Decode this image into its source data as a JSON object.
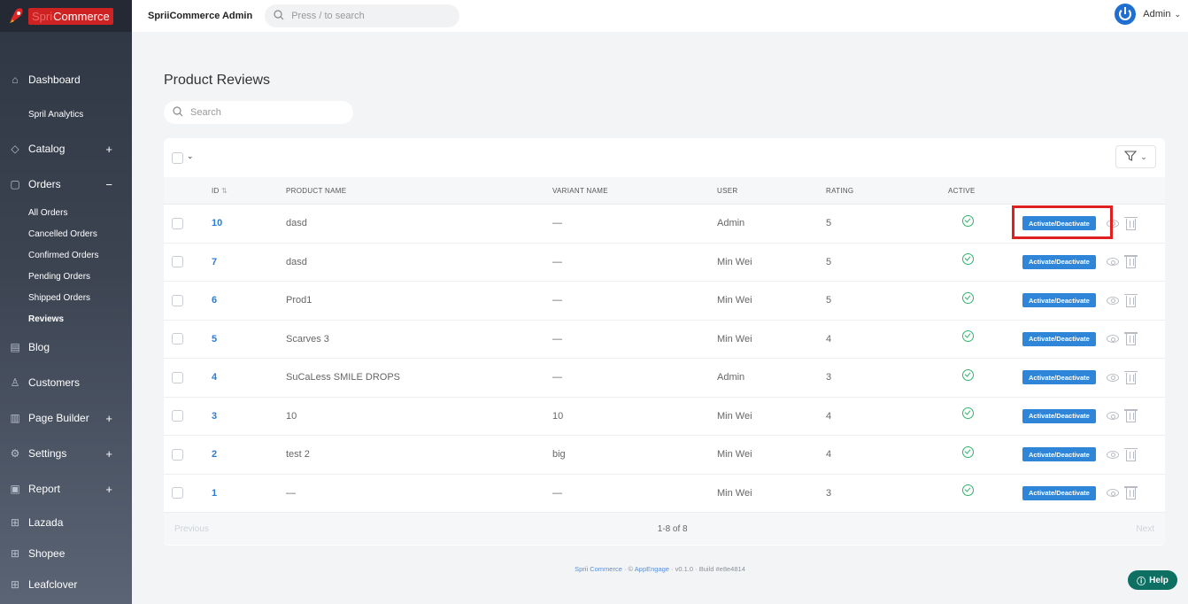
{
  "brand": {
    "name_faded": "Spri",
    "name": "Commerce"
  },
  "topbar": {
    "title": "SpriiCommerce Admin",
    "search_placeholder": "Press / to search",
    "user": "Admin"
  },
  "sidebar": {
    "items": [
      {
        "label": "Dashboard",
        "icon": "home-icon",
        "plus": ""
      },
      {
        "label": "Spril Analytics",
        "icon": "",
        "plus": ""
      },
      {
        "label": "Catalog",
        "icon": "tag-icon",
        "plus": "+"
      },
      {
        "label": "Orders",
        "icon": "bag-icon",
        "plus": "−"
      }
    ],
    "order_subitems": [
      "All Orders",
      "Cancelled Orders",
      "Confirmed Orders",
      "Pending Orders",
      "Shipped Orders",
      "Reviews"
    ],
    "items2": [
      {
        "label": "Blog",
        "icon": "blog-icon",
        "plus": ""
      },
      {
        "label": "Customers",
        "icon": "user-icon",
        "plus": ""
      },
      {
        "label": "Page Builder",
        "icon": "page-builder-icon",
        "plus": "+"
      },
      {
        "label": "Settings",
        "icon": "gear-icon",
        "plus": "+"
      },
      {
        "label": "Report",
        "icon": "report-icon",
        "plus": "+"
      },
      {
        "label": "Lazada",
        "icon": "grid-icon",
        "plus": ""
      },
      {
        "label": "Shopee",
        "icon": "grid-icon",
        "plus": ""
      },
      {
        "label": "Leafclover",
        "icon": "grid-icon",
        "plus": ""
      }
    ]
  },
  "main": {
    "title": "Product Reviews",
    "search_placeholder": "Search",
    "columns": {
      "id": "ID",
      "product": "PRODUCT NAME",
      "variant": "VARIANT NAME",
      "user": "USER",
      "rating": "RATING",
      "active": "ACTIVE"
    },
    "action_label": "Activate/Deactivate",
    "rows": [
      {
        "id": "10",
        "product": "dasd",
        "variant": "—",
        "user": "Admin",
        "rating": "5"
      },
      {
        "id": "7",
        "product": "dasd",
        "variant": "—",
        "user": "Min Wei",
        "rating": "5"
      },
      {
        "id": "6",
        "product": "Prod1",
        "variant": "—",
        "user": "Min Wei",
        "rating": "5"
      },
      {
        "id": "5",
        "product": "Scarves 3",
        "variant": "—",
        "user": "Min Wei",
        "rating": "4"
      },
      {
        "id": "4",
        "product": "SuCaLess SMILE DROPS",
        "variant": "—",
        "user": "Admin",
        "rating": "3"
      },
      {
        "id": "3",
        "product": "10",
        "variant": "10",
        "user": "Min Wei",
        "rating": "4"
      },
      {
        "id": "2",
        "product": "test 2",
        "variant": "big",
        "user": "Min Wei",
        "rating": "4"
      },
      {
        "id": "1",
        "product": "—",
        "variant": "—",
        "user": "Min Wei",
        "rating": "3"
      }
    ],
    "pager": {
      "previous": "Previous",
      "info": "1-8 of 8",
      "next": "Next"
    }
  },
  "footer": {
    "brand": "Sprii Commerce",
    "sep1": " · © ",
    "vendor": "AppEngage",
    "rest": " · v0.1.0 · Build #e8e4814"
  },
  "help": "Help"
}
